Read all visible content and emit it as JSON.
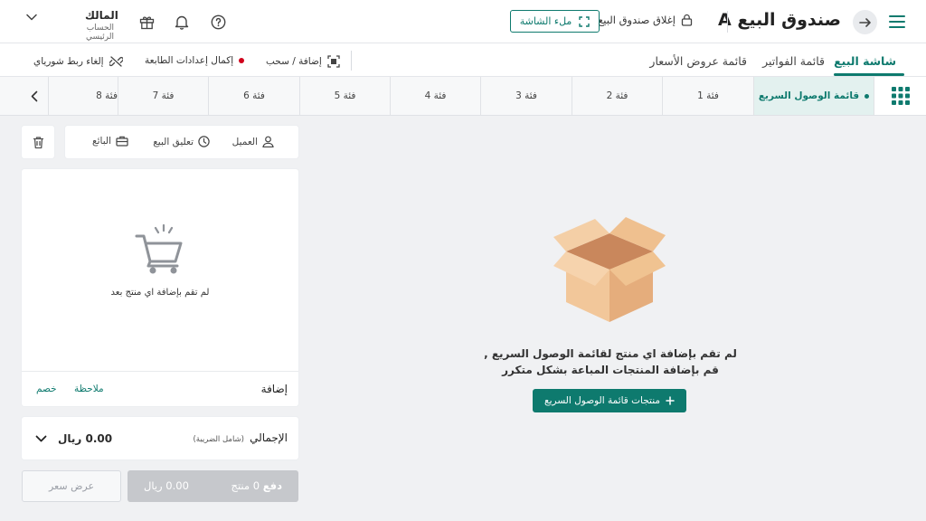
{
  "header": {
    "title": "صندوق البيع A",
    "close_box_label": "إغلاق صندوق البيع",
    "fullscreen_label": "ملء الشاشة",
    "owner_name": "المالك",
    "owner_account": "الحساب الرئيسي",
    "icons": [
      "menu-icon",
      "arrow-right-icon",
      "lock-icon",
      "expand-icon",
      "help-icon",
      "bell-icon",
      "gift-icon",
      "chevron-down-icon"
    ]
  },
  "tabs": [
    {
      "label": "شاشة البيع",
      "active": true
    },
    {
      "label": "قائمة الفواتير",
      "active": false
    },
    {
      "label": "قائمة عروض الأسعار",
      "active": false
    }
  ],
  "tools": {
    "add_drag": "إضافة / سحب",
    "complete_printer": "إكمال إعدادات الطابعة",
    "unlink_shoraye": "إلغاء ربط شورياي"
  },
  "categories": {
    "quick_access": "قائمة الوصول السريع",
    "items": [
      "فئة 1",
      "فئة 2",
      "فئة 3",
      "فئة 4",
      "فئة 5",
      "فئة 6",
      "فئة 7",
      "فئة 8"
    ]
  },
  "cart": {
    "customer": "العميل",
    "hold_sale": "تعليق البيع",
    "seller": "البائع",
    "empty_text": "لم تقم بإضافة اي منتج بعد",
    "add_label": "إضافة",
    "note_label": "ملاحظة",
    "discount_label": "خصم",
    "total_label": "الإجمالي",
    "total_tax_note": "(شامل الضريبة)",
    "total_amount": "0.00 ريال",
    "pay_label": "دفع",
    "pay_count": "0 منتج",
    "pay_amount": "0.00 ريال",
    "quote_label": "عرض سعر"
  },
  "main": {
    "empty_line1": "لم تقم بإضافة اي منتج لقائمة الوصول السريع ,",
    "empty_line2": "قم بإضافة المنتجات المباعة بشكل متكرر",
    "quick_button": "منتجات قائمة الوصول السريع"
  },
  "colors": {
    "accent": "#0e7a6e",
    "alert": "#d0021b",
    "disabled": "#c6c8cc"
  }
}
